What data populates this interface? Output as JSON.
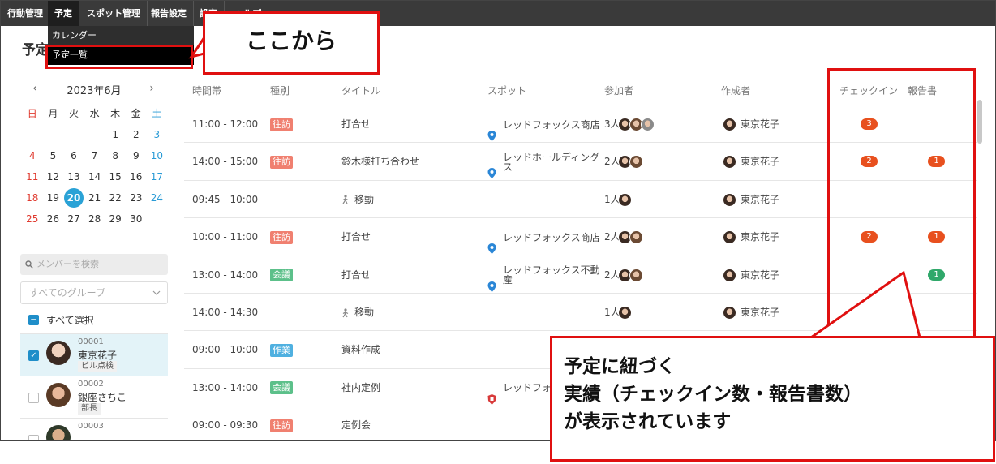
{
  "nav": {
    "items": [
      "行動管理",
      "予定",
      "スポット管理",
      "報告設定",
      "設定",
      "ヘルプ"
    ],
    "dropdown": [
      "カレンダー",
      "予定一覧"
    ]
  },
  "page_title": "予定一覧",
  "calendar": {
    "month": "2023年6月",
    "prev": "‹",
    "next": "›",
    "weekdays": [
      "日",
      "月",
      "火",
      "水",
      "木",
      "金",
      "土"
    ],
    "weeks": [
      [
        "",
        "",
        "",
        "",
        "1",
        "2",
        "3"
      ],
      [
        "4",
        "5",
        "6",
        "7",
        "8",
        "9",
        "10"
      ],
      [
        "11",
        "12",
        "13",
        "14",
        "15",
        "16",
        "17"
      ],
      [
        "18",
        "19",
        "20",
        "21",
        "22",
        "23",
        "24"
      ],
      [
        "25",
        "26",
        "27",
        "28",
        "29",
        "30",
        ""
      ]
    ],
    "today": "20"
  },
  "member_search": {
    "placeholder": "メンバーを検索"
  },
  "group_select": {
    "value": "すべてのグループ"
  },
  "select_all": "すべて選択",
  "members": [
    {
      "code": "00001",
      "name": "東京花子",
      "tag": "ビル点検",
      "checked": true
    },
    {
      "code": "00002",
      "name": "銀座さちこ",
      "tag": "部長",
      "checked": false
    },
    {
      "code": "00003",
      "name": "",
      "tag": "",
      "checked": false
    }
  ],
  "table": {
    "headers": [
      "時間帯",
      "種別",
      "タイトル",
      "スポット",
      "参加者",
      "作成者",
      "チェックイン",
      "報告書"
    ],
    "rows": [
      {
        "time": "11:00 - 12:00",
        "type": "往訪",
        "type_color": "#f08070",
        "title": "打合せ",
        "spot": "レッドフォックス商店",
        "spot_icon": "pin",
        "participants": "3人",
        "avatars": 3,
        "creator": "東京花子",
        "checkin": "3",
        "report": ""
      },
      {
        "time": "14:00 - 15:00",
        "type": "往訪",
        "type_color": "#f08070",
        "title": "鈴木様打ち合わせ",
        "spot": "レッドホールディングス",
        "spot_icon": "pin",
        "participants": "2人",
        "avatars": 2,
        "creator": "東京花子",
        "checkin": "2",
        "report": "1"
      },
      {
        "time": "09:45 - 10:00",
        "type": "",
        "type_color": "",
        "title": "移動",
        "title_icon": "walk",
        "spot": "",
        "spot_icon": "",
        "participants": "1人",
        "avatars": 1,
        "creator": "東京花子",
        "checkin": "",
        "report": ""
      },
      {
        "time": "10:00 - 11:00",
        "type": "往訪",
        "type_color": "#f08070",
        "title": "打合せ",
        "spot": "レッドフォックス商店",
        "spot_icon": "pin",
        "participants": "2人",
        "avatars": 2,
        "creator": "東京花子",
        "checkin": "2",
        "report": "1"
      },
      {
        "time": "13:00 - 14:00",
        "type": "会議",
        "type_color": "#5cc08a",
        "title": "打合せ",
        "spot": "レッドフォックス不動産",
        "spot_icon": "pin",
        "participants": "2人",
        "avatars": 2,
        "creator": "東京花子",
        "checkin": "",
        "report": "1",
        "report_color": "#2fa86a"
      },
      {
        "time": "14:00 - 14:30",
        "type": "",
        "type_color": "",
        "title": "移動",
        "title_icon": "walk",
        "spot": "",
        "spot_icon": "",
        "participants": "1人",
        "avatars": 1,
        "creator": "東京花子",
        "checkin": "",
        "report": ""
      },
      {
        "time": "09:00 - 10:00",
        "type": "作業",
        "type_color": "#4fb0e0",
        "title": "資料作成",
        "spot": "",
        "spot_icon": "",
        "participants": "",
        "avatars": 0,
        "creator": "",
        "checkin": "",
        "report": ""
      },
      {
        "time": "13:00 - 14:00",
        "type": "会議",
        "type_color": "#5cc08a",
        "title": "社内定例",
        "spot": "レッドフォ会社",
        "spot_icon": "shield",
        "participants": "",
        "avatars": 0,
        "creator": "",
        "checkin": "",
        "report": ""
      },
      {
        "time": "09:00 - 09:30",
        "type": "往訪",
        "type_color": "#f08070",
        "title": "定例会",
        "spot": "",
        "spot_icon": "",
        "participants": "",
        "avatars": 0,
        "creator": "",
        "checkin": "",
        "report": ""
      }
    ]
  },
  "annotations": {
    "start_here": "ここから",
    "result_lines": [
      "予定に紐づく",
      "実績（チェックイン数・報告書数）",
      "が表示されています"
    ]
  },
  "colors": {
    "accent": "#2aa2d6",
    "count_badge": "#e8501e",
    "highlight": "#e01010"
  }
}
